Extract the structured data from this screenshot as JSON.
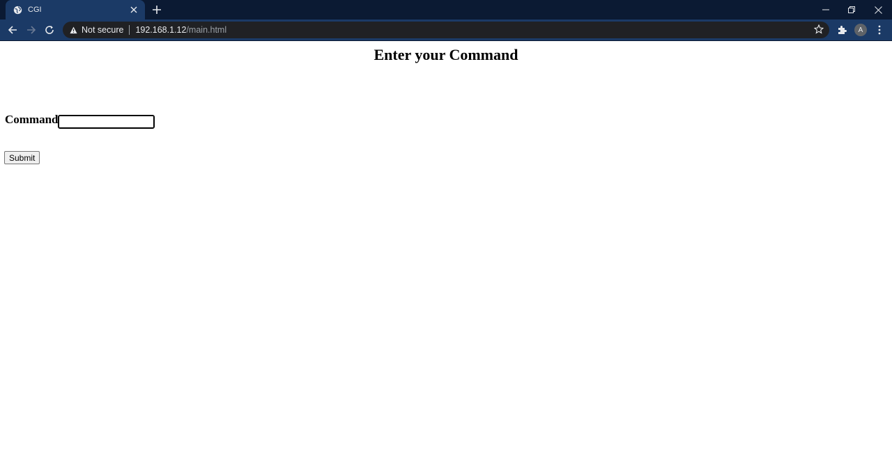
{
  "browser": {
    "tab": {
      "title": "CGI",
      "favicon": "globe-icon",
      "close_icon": "close-icon"
    },
    "new_tab_icon": "plus-icon",
    "window_controls": [
      "minimize-icon",
      "restore-icon",
      "close-icon"
    ],
    "toolbar": {
      "back_icon": "arrow-left-icon",
      "forward_icon": "arrow-right-icon",
      "reload_icon": "reload-icon",
      "extensions_icon": "puzzle-icon",
      "profile_initial": "A",
      "menu_icon": "kebab-menu-icon"
    },
    "address": {
      "security_icon": "warning-triangle-icon",
      "security_label": "Not secure",
      "host": "192.168.1.12",
      "path": "/main.html",
      "bookmark_icon": "star-icon"
    },
    "colors": {
      "tabstrip_bg": "#0b1a33",
      "toolbar_bg": "#1b3a66",
      "omnibox_bg": "#202124"
    }
  },
  "page": {
    "heading": "Enter your Command",
    "command_label": "Command",
    "command_value": "",
    "submit_label": "Submit"
  }
}
